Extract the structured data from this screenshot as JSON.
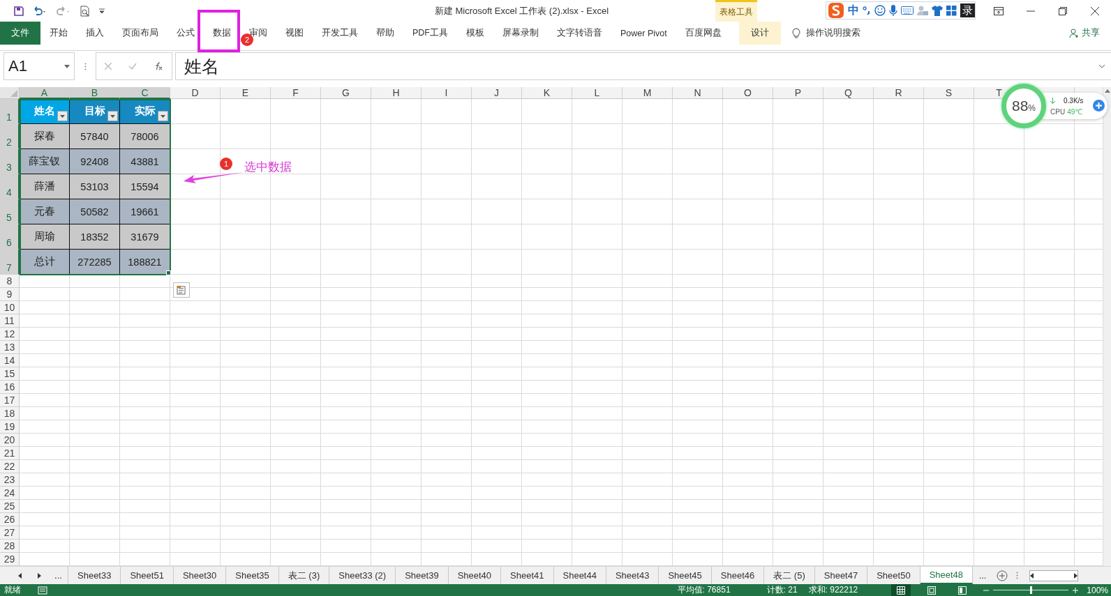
{
  "window": {
    "title": "新建 Microsoft Excel 工作表 (2).xlsx  -  Excel",
    "context_group": "表格工具"
  },
  "ime_toolbar": {
    "mode": "中",
    "cut_label": "录"
  },
  "ribbon_tabs": [
    {
      "label": "文件",
      "kind": "file",
      "selected": false
    },
    {
      "label": "开始",
      "kind": "tab",
      "selected": false
    },
    {
      "label": "插入",
      "kind": "tab",
      "selected": false
    },
    {
      "label": "页面布局",
      "kind": "tab",
      "selected": false
    },
    {
      "label": "公式",
      "kind": "tab",
      "selected": false
    },
    {
      "label": "数据",
      "kind": "tab",
      "selected": false
    },
    {
      "label": "审阅",
      "kind": "tab",
      "selected": false
    },
    {
      "label": "视图",
      "kind": "tab",
      "selected": false
    },
    {
      "label": "开发工具",
      "kind": "tab",
      "selected": false
    },
    {
      "label": "帮助",
      "kind": "tab",
      "selected": false
    },
    {
      "label": "PDF工具",
      "kind": "tab",
      "selected": false
    },
    {
      "label": "模板",
      "kind": "tab",
      "selected": false
    },
    {
      "label": "屏幕录制",
      "kind": "tab",
      "selected": false
    },
    {
      "label": "文字转语音",
      "kind": "tab",
      "selected": false
    },
    {
      "label": "Power Pivot",
      "kind": "tab",
      "selected": false
    },
    {
      "label": "百度网盘",
      "kind": "tab",
      "selected": false
    },
    {
      "label": "设计",
      "kind": "contextual",
      "selected": false
    }
  ],
  "tell_me": "操作说明搜索",
  "share": "共享",
  "name_box": "A1",
  "formula": "姓名",
  "columns": [
    {
      "label": "A",
      "selected": true
    },
    {
      "label": "B",
      "selected": true
    },
    {
      "label": "C",
      "selected": true
    },
    {
      "label": "D",
      "selected": false
    },
    {
      "label": "E",
      "selected": false
    },
    {
      "label": "F",
      "selected": false
    },
    {
      "label": "G",
      "selected": false
    },
    {
      "label": "H",
      "selected": false
    },
    {
      "label": "I",
      "selected": false
    },
    {
      "label": "J",
      "selected": false
    },
    {
      "label": "K",
      "selected": false
    },
    {
      "label": "L",
      "selected": false
    },
    {
      "label": "M",
      "selected": false
    },
    {
      "label": "N",
      "selected": false
    },
    {
      "label": "O",
      "selected": false
    },
    {
      "label": "P",
      "selected": false
    },
    {
      "label": "Q",
      "selected": false
    },
    {
      "label": "R",
      "selected": false
    },
    {
      "label": "S",
      "selected": false
    },
    {
      "label": "T",
      "selected": false
    }
  ],
  "rows": [
    {
      "label": "1",
      "selected": true
    },
    {
      "label": "2",
      "selected": true
    },
    {
      "label": "3",
      "selected": true
    },
    {
      "label": "4",
      "selected": true
    },
    {
      "label": "5",
      "selected": true
    },
    {
      "label": "6",
      "selected": true
    },
    {
      "label": "7",
      "selected": true
    },
    {
      "label": "8",
      "selected": false
    },
    {
      "label": "9",
      "selected": false
    },
    {
      "label": "10",
      "selected": false
    },
    {
      "label": "11",
      "selected": false
    },
    {
      "label": "12",
      "selected": false
    },
    {
      "label": "13",
      "selected": false
    },
    {
      "label": "14",
      "selected": false
    },
    {
      "label": "15",
      "selected": false
    },
    {
      "label": "16",
      "selected": false
    },
    {
      "label": "17",
      "selected": false
    },
    {
      "label": "18",
      "selected": false
    },
    {
      "label": "19",
      "selected": false
    },
    {
      "label": "20",
      "selected": false
    },
    {
      "label": "21",
      "selected": false
    },
    {
      "label": "22",
      "selected": false
    },
    {
      "label": "23",
      "selected": false
    },
    {
      "label": "24",
      "selected": false
    },
    {
      "label": "25",
      "selected": false
    },
    {
      "label": "26",
      "selected": false
    },
    {
      "label": "27",
      "selected": false
    },
    {
      "label": "28",
      "selected": false
    },
    {
      "label": "29",
      "selected": false
    }
  ],
  "table": {
    "headers": [
      {
        "label": "姓名",
        "active": true
      },
      {
        "label": "目标",
        "active": false
      },
      {
        "label": "实际",
        "active": false
      }
    ],
    "rows": [
      [
        "探春",
        "57840",
        "78006"
      ],
      [
        "薛宝钗",
        "92408",
        "43881"
      ],
      [
        "薛潘",
        "53103",
        "15594"
      ],
      [
        "元春",
        "50582",
        "19661"
      ],
      [
        "周瑜",
        "18352",
        "31679"
      ],
      [
        "总计",
        "272285",
        "188821"
      ]
    ]
  },
  "callouts": {
    "tab_badge": "2",
    "selection_badge": "1",
    "selection_caption": "选中数据"
  },
  "system_monitor": {
    "load": "88",
    "load_unit": "%",
    "net_speed": "0.3K/s",
    "cpu_label": "CPU",
    "cpu_temp": "49℃"
  },
  "sheet_nav": {
    "more_left": "...",
    "more_right": "..."
  },
  "sheet_tabs": [
    {
      "label": "Sheet33",
      "selected": false
    },
    {
      "label": "Sheet51",
      "selected": false
    },
    {
      "label": "Sheet30",
      "selected": false
    },
    {
      "label": "Sheet35",
      "selected": false
    },
    {
      "label": "表二 (3)",
      "selected": false
    },
    {
      "label": "Sheet33 (2)",
      "selected": false
    },
    {
      "label": "Sheet39",
      "selected": false
    },
    {
      "label": "Sheet40",
      "selected": false
    },
    {
      "label": "Sheet41",
      "selected": false
    },
    {
      "label": "Sheet44",
      "selected": false
    },
    {
      "label": "Sheet43",
      "selected": false
    },
    {
      "label": "Sheet45",
      "selected": false
    },
    {
      "label": "Sheet46",
      "selected": false
    },
    {
      "label": "表二 (5)",
      "selected": false
    },
    {
      "label": "Sheet47",
      "selected": false
    },
    {
      "label": "Sheet50",
      "selected": false
    },
    {
      "label": "Sheet48",
      "selected": true
    }
  ],
  "status_bar": {
    "ready": "就绪",
    "average": "平均值: 76851",
    "count": "计数: 21",
    "sum": "求和: 922212",
    "views": [
      {
        "kind": "normal",
        "selected": true
      },
      {
        "kind": "page_layout",
        "selected": false
      },
      {
        "kind": "page_break",
        "selected": false
      }
    ],
    "zoom": {
      "level": 0.5,
      "label": "100%"
    }
  }
}
